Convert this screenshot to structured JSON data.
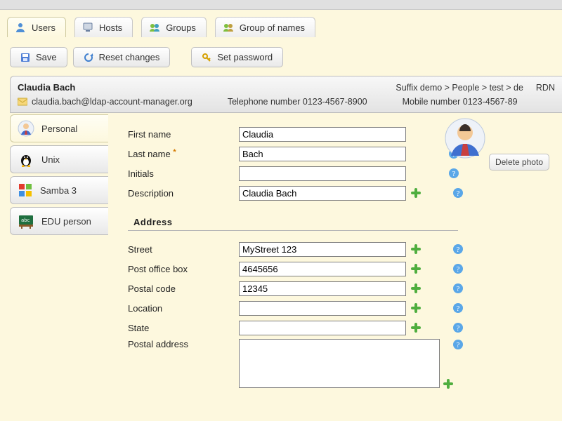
{
  "nav": {
    "users": "Users",
    "hosts": "Hosts",
    "groups": "Groups",
    "group_of_names": "Group of names"
  },
  "actions": {
    "save": "Save",
    "reset": "Reset changes",
    "set_password": "Set password"
  },
  "summary": {
    "name": "Claudia Bach",
    "suffix": "Suffix demo > People > test > de",
    "rdn": "RDN",
    "email": "claudia.bach@ldap-account-manager.org",
    "tel_label": "Telephone number",
    "tel_value": "0123-4567-8900",
    "mob_label": "Mobile number",
    "mob_value": "0123-4567-89"
  },
  "sidetabs": {
    "personal": "Personal",
    "unix": "Unix",
    "samba": "Samba 3",
    "edu": "EDU person"
  },
  "form": {
    "first_name": {
      "label": "First name",
      "value": "Claudia"
    },
    "last_name": {
      "label": "Last name",
      "value": "Bach"
    },
    "initials": {
      "label": "Initials",
      "value": ""
    },
    "description": {
      "label": "Description",
      "value": "Claudia Bach"
    },
    "section_address": "Address",
    "street": {
      "label": "Street",
      "value": "MyStreet 123"
    },
    "pobox": {
      "label": "Post office box",
      "value": "4645656"
    },
    "postal": {
      "label": "Postal code",
      "value": "12345"
    },
    "location": {
      "label": "Location",
      "value": ""
    },
    "state": {
      "label": "State",
      "value": ""
    },
    "postal_addr": {
      "label": "Postal address",
      "value": ""
    }
  },
  "photo": {
    "delete": "Delete photo"
  }
}
